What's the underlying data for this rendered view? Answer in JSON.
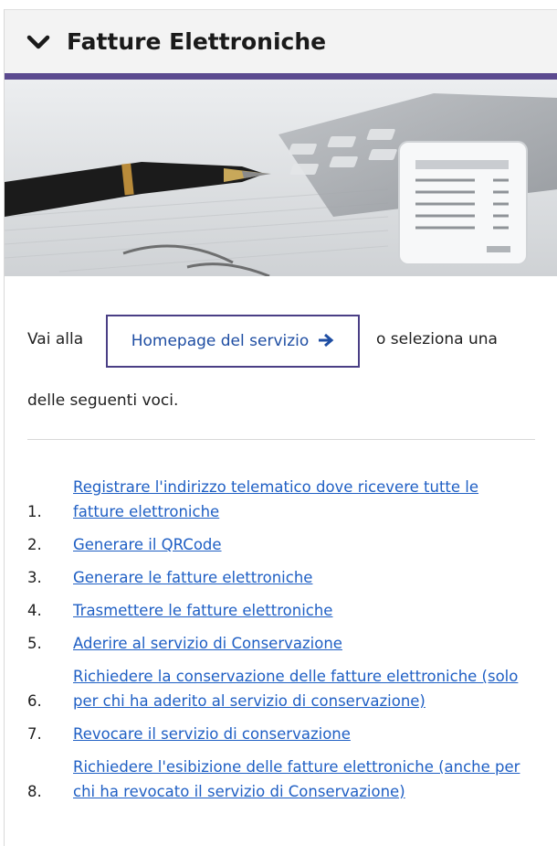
{
  "header": {
    "title": "Fatture Elettroniche",
    "toggle_icon": "chevron-down-icon"
  },
  "hero": {
    "image_subject": "pen-calculator-documents-illustration"
  },
  "intro": {
    "prefix": "Vai alla",
    "button_label": "Homepage del servizio",
    "button_icon": "arrow-right-icon",
    "suffix": "o seleziona una",
    "line2": "delle seguenti voci."
  },
  "steps": [
    {
      "number": "1.",
      "label": "Registrare l'indirizzo telematico dove ricevere tutte le fatture elettroniche"
    },
    {
      "number": "2.",
      "label": "Generare il QRCode"
    },
    {
      "number": "3.",
      "label": "Generare le fatture elettroniche"
    },
    {
      "number": "4.",
      "label": "Trasmettere le fatture elettroniche"
    },
    {
      "number": "5.",
      "label": "Aderire al servizio di Conservazione"
    },
    {
      "number": "6.",
      "label": "Richiedere la conservazione delle fatture elettroniche (solo per chi ha aderito al servizio di conservazione)"
    },
    {
      "number": "7.",
      "label": "Revocare il servizio di conservazione"
    },
    {
      "number": "8.",
      "label": "Richiedere l'esibizione delle fatture elettroniche (anche per chi ha revocato il servizio di Conservazione)"
    }
  ],
  "colors": {
    "accent": "#5b4a8f",
    "link": "#1f5fc4",
    "button_border": "#4a3f85"
  }
}
